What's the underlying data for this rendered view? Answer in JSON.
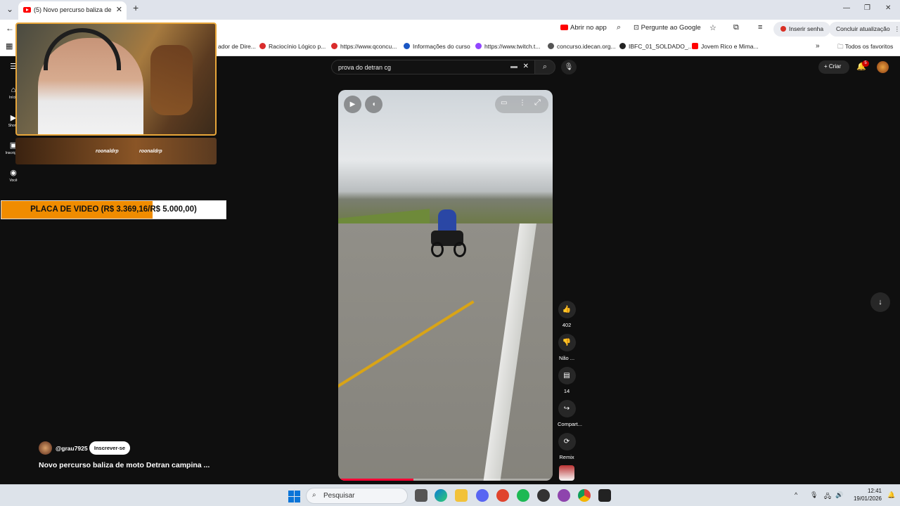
{
  "browser": {
    "tab_title": "(5) Novo percurso baliza de mo",
    "new_tab": "+",
    "close_tab": "✕",
    "open_in_app": "Abrir no app",
    "ask_google": "Pergunte ao Google",
    "insert_password": "Inserir senha",
    "finish_update": "Concluir atualização",
    "bookmarks": [
      {
        "label": "ador de Dire...",
        "color": "#888888"
      },
      {
        "label": "Raciocínio Lógico p...",
        "color": "#d92b2b"
      },
      {
        "label": "https://www.qconcu...",
        "color": "#d92b2b"
      },
      {
        "label": "Informações do curso",
        "color": "#1a56c4"
      },
      {
        "label": "https://www.twitch.t...",
        "color": "#9146ff"
      },
      {
        "label": "concurso.idecan.org...",
        "color": "#555555"
      },
      {
        "label": "IBFC_01_SOLDADO_...",
        "color": "#222222"
      },
      {
        "label": "Jovem Rico e Mima...",
        "color": "#ff0000"
      }
    ],
    "all_bookmarks": "Todos os favoritos"
  },
  "youtube": {
    "search_query": "prova do detran cg",
    "create_label": "Criar",
    "notification_count": "5",
    "sidebar": [
      {
        "label": "Início",
        "icon": "home-icon"
      },
      {
        "label": "Shorts",
        "icon": "shorts-icon"
      },
      {
        "label": "Inscrições",
        "icon": "subscriptions-icon"
      },
      {
        "label": "Você",
        "icon": "you-icon"
      }
    ],
    "actions": {
      "likes": "402",
      "dislike": "Não ...",
      "comments": "14",
      "share": "Compart...",
      "remix": "Remix"
    },
    "channel_handle": "@grau7925",
    "subscribe_label": "Inscrever-se",
    "video_title": "Novo percurso baliza de moto Detran campina ...",
    "video_progress": 0.35
  },
  "overlay": {
    "streamer_tags": [
      "roonaldrp",
      "roonaldrp"
    ],
    "goal_label": "PLACA DE VIDEO (R$ 3.369,16/R$ 5.000,00)",
    "goal_progress": 0.674,
    "goal_color": "#f08c00"
  },
  "taskbar": {
    "search_placeholder": "Pesquisar",
    "time": "12:41",
    "date": "19/01/2026"
  }
}
